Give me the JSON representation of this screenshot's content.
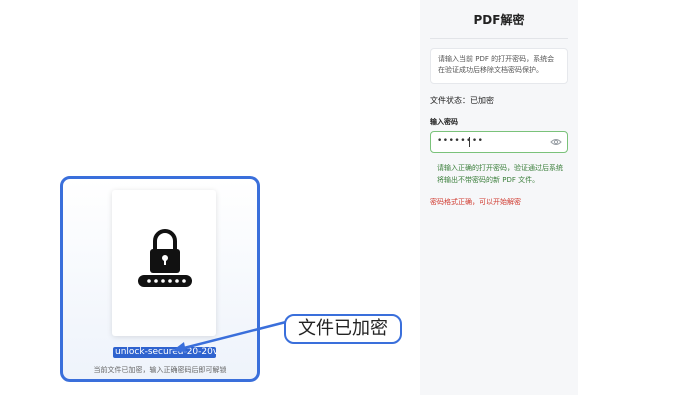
{
  "file_preview": {
    "file_name": "unlock-secured-20-20vl7x4n7.pdf",
    "hint": "当前文件已加密，输入正确密码后即可解锁"
  },
  "callout": {
    "text": "文件已加密"
  },
  "panel": {
    "title": "PDF解密",
    "info": "请输入当前 PDF 的打开密码，系统会在验证成功后移除文档密码保护。",
    "status_label": "文件状态：",
    "status_value": "已加密",
    "password_label": "输入密码",
    "password_value": "••••••••",
    "help_text": "请输入正确的打开密码，验证通过后系统将输出不带密码的新 PDF 文件。",
    "validation_message": "密码格式正确，可以开始解密"
  },
  "colors": {
    "accent": "#3a6fdb",
    "success": "#7ac27a",
    "error": "#d03a2f"
  }
}
